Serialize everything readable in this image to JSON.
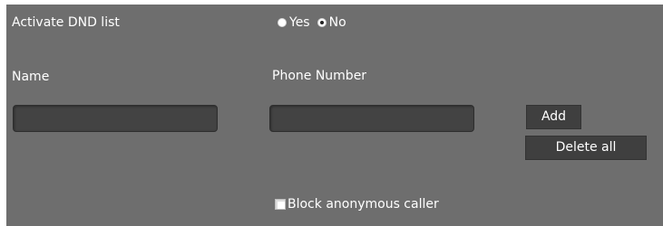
{
  "dnd": {
    "label": "Activate DND list",
    "options": [
      {
        "label": "Yes",
        "selected": false
      },
      {
        "label": "No",
        "selected": true
      }
    ]
  },
  "columns": {
    "name_label": "Name",
    "phone_label": "Phone Number"
  },
  "inputs": {
    "name_value": "",
    "phone_value": ""
  },
  "buttons": {
    "add_label": "Add",
    "delete_all_label": "Delete all"
  },
  "block_anonymous": {
    "label": "Block anonymous caller",
    "checked": false
  },
  "colors": {
    "panel_bg": "#6e6e6e",
    "input_bg": "#434343",
    "button_bg": "#3f3f3f",
    "text": "#ffffff"
  }
}
